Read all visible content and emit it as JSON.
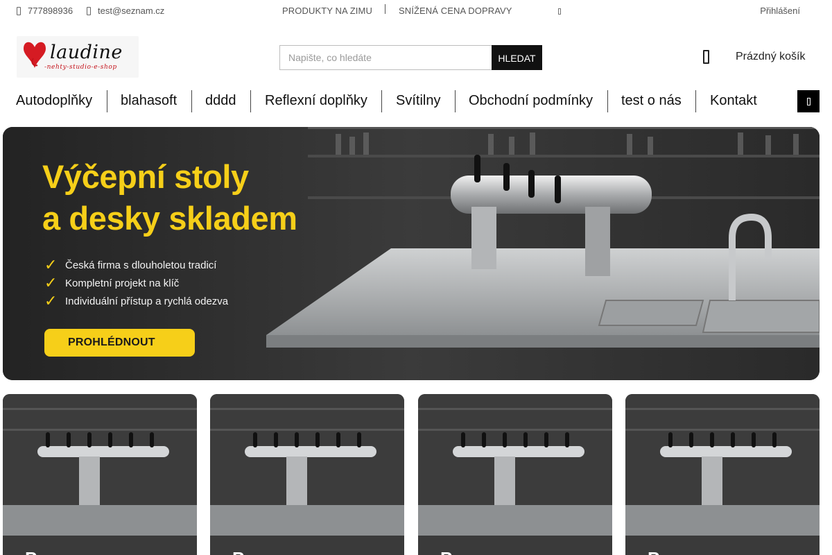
{
  "topbar": {
    "phone": "777898936",
    "email": "test@seznam.cz",
    "links": [
      "PRODUKTY NA ZIMU",
      "SNÍŽENÁ CENA DOPRAVY"
    ],
    "login": "Přihlášení"
  },
  "logo": {
    "text": "laudine",
    "tagline": "-nehty-studio-e-shop"
  },
  "search": {
    "placeholder": "Napište, co hledáte",
    "button": "HLEDAT"
  },
  "cart": {
    "label": "Prázdný košík"
  },
  "nav": {
    "items": [
      "Autodoplňky",
      "blahasoft",
      "dddd",
      "Reflexní doplňky",
      "Svítilny",
      "Obchodní podmínky",
      "test o nás",
      "Kontakt"
    ]
  },
  "hero": {
    "line1": "Výčepní stoly",
    "line2": "a desky skladem",
    "features": [
      "Česká firma s dlouholetou tradicí",
      "Kompletní projekt na klíč",
      "Individuální přístup a rychlá odezva"
    ],
    "cta": "PROHLÉDNOUT"
  },
  "cards": [
    {
      "caption": "Pr"
    },
    {
      "caption": "Pr"
    },
    {
      "caption": "Pr"
    },
    {
      "caption": "Pr"
    }
  ],
  "colors": {
    "accent_yellow": "#f6cf19",
    "button_black": "#111111",
    "logo_red": "#c4121a"
  }
}
